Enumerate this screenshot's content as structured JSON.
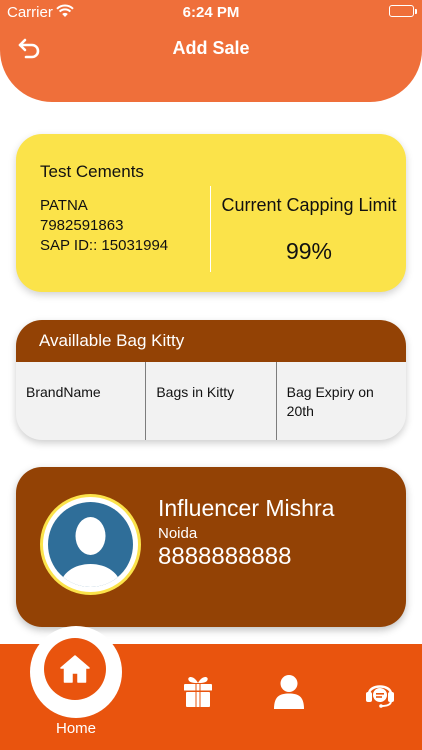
{
  "status_bar": {
    "carrier": "Carrier",
    "time": "6:24 PM"
  },
  "header": {
    "title": "Add Sale",
    "back_icon": "back-arrow-icon"
  },
  "dealer_card": {
    "company": "Test Cements",
    "city": "PATNA",
    "phone": "7982591863",
    "sap_id": "SAP ID:: 15031994",
    "capping_label": "Current Capping Limit",
    "capping_value": "99%"
  },
  "bag_kitty": {
    "title": "Availlable Bag Kitty",
    "columns": [
      "BrandName",
      "Bags in Kitty",
      "Bag Expiry on 20th"
    ]
  },
  "influencer": {
    "name": "Influencer Mishra",
    "city": "Noida",
    "phone": "8888888888",
    "avatar_icon": "user-avatar-icon"
  },
  "bottom_nav": {
    "items": [
      {
        "label": "Home",
        "icon": "home-icon"
      },
      {
        "label": "",
        "icon": "gift-icon"
      },
      {
        "label": "",
        "icon": "user-icon"
      },
      {
        "label": "",
        "icon": "support-icon"
      }
    ]
  },
  "colors": {
    "header": "#ef6f3a",
    "dealer_card": "#fbe34a",
    "brown": "#934205",
    "nav": "#e9540e"
  }
}
